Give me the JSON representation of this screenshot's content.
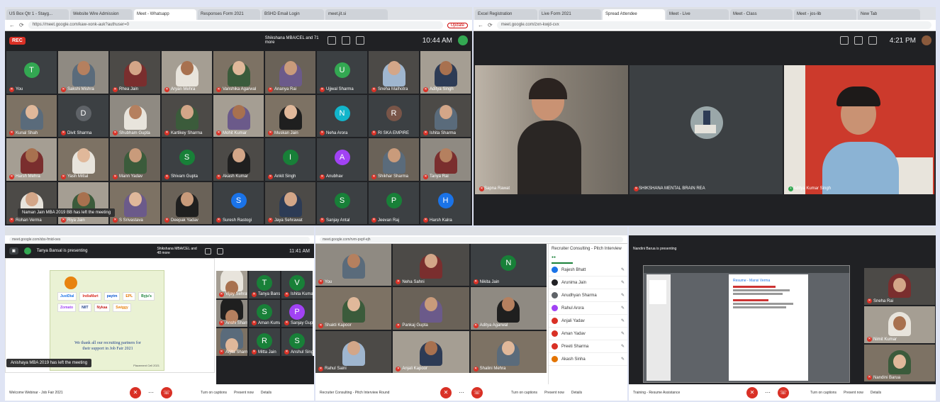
{
  "q1": {
    "tabs": [
      "US Box Qtr 1 - Stayg...",
      "Website Wire Admission",
      "Meet - Whatsapp",
      "Responses Form 2021",
      "BSHD Email Login",
      "meet.jit.si"
    ],
    "url": "https://meet.google.com/kaw-xonk-auk?authuser=0",
    "update_label": "Update",
    "rec_label": "REC",
    "presenter": "Shikshana MBA/CEL and 71 more",
    "clock": "10:44 AM",
    "left_notice": "Naman Jain MBA 2019 BB has left the meeting",
    "participants": [
      {
        "name": "You",
        "letter": "T",
        "color": "#33a852"
      },
      {
        "name": "Sakshi Mishra",
        "letter": "",
        "color": ""
      },
      {
        "name": "Rhea Jain",
        "letter": "",
        "color": ""
      },
      {
        "name": "Aryan Mehra",
        "letter": "",
        "color": ""
      },
      {
        "name": "Vanshika Agarwal",
        "letter": "",
        "color": ""
      },
      {
        "name": "Ananya Rai",
        "letter": "",
        "color": ""
      },
      {
        "name": "Ujjwal Sharma",
        "letter": "U",
        "color": "#33a852"
      },
      {
        "name": "Sneha Malhotra",
        "letter": "",
        "color": ""
      },
      {
        "name": "Aditya Singh",
        "letter": "",
        "color": ""
      },
      {
        "name": "Kunal Shah",
        "letter": "",
        "color": ""
      },
      {
        "name": "Divit Sharma",
        "letter": "D",
        "color": "#5f6368"
      },
      {
        "name": "Shubham Gupta",
        "letter": "",
        "color": ""
      },
      {
        "name": "Kartikey Sharma",
        "letter": "",
        "color": ""
      },
      {
        "name": "Mohit Kumar",
        "letter": "",
        "color": ""
      },
      {
        "name": "Muskan Jain",
        "letter": "",
        "color": ""
      },
      {
        "name": "Neha Arora",
        "letter": "N",
        "color": "#12b5cb"
      },
      {
        "name": "RI SKA EMPIRE",
        "letter": "R",
        "color": "#795548"
      },
      {
        "name": "Ishita Sharma",
        "letter": "",
        "color": ""
      },
      {
        "name": "Harsh Mehra",
        "letter": "",
        "color": ""
      },
      {
        "name": "Yash Mittal",
        "letter": "",
        "color": ""
      },
      {
        "name": "Mann Yadav",
        "letter": "",
        "color": ""
      },
      {
        "name": "Shivam Gupta",
        "letter": "S",
        "color": "#188038"
      },
      {
        "name": "Akash Kumar",
        "letter": "",
        "color": ""
      },
      {
        "name": "Ankit Singh",
        "letter": "I",
        "color": "#188038"
      },
      {
        "name": "Anubhav",
        "letter": "A",
        "color": "#a142f4"
      },
      {
        "name": "Shikhar Sharma",
        "letter": "",
        "color": ""
      },
      {
        "name": "Tanya Rai",
        "letter": "",
        "color": ""
      },
      {
        "name": "Rohan Verma",
        "letter": "",
        "color": ""
      },
      {
        "name": "Riya Jain",
        "letter": "",
        "color": ""
      },
      {
        "name": "S Srivastava",
        "letter": "",
        "color": ""
      },
      {
        "name": "Deepak Yadav",
        "letter": "",
        "color": ""
      },
      {
        "name": "Suresh Rastogi",
        "letter": "S",
        "color": "#1a73e8"
      },
      {
        "name": "Jaya Sehrawat",
        "letter": "",
        "color": ""
      },
      {
        "name": "Sanjay Antal",
        "letter": "S",
        "color": "#188038"
      },
      {
        "name": "Jeevan Raj",
        "letter": "P",
        "color": "#188038"
      },
      {
        "name": "Harsh Kalra",
        "letter": "H",
        "color": "#1a73e8"
      }
    ]
  },
  "q2": {
    "tabs": [
      "Excel Registration",
      "Live Form 2021",
      "Spread Attendee",
      "Meet - Live",
      "Meet - Class",
      "Meet - jos-lib",
      "New Tab"
    ],
    "url": "meet.google.com/zxn-kwjd-cvx",
    "clock": "4:21 PM",
    "speakers": [
      {
        "name": "Sapna Rawat"
      },
      {
        "name": "SHIKSHANA MENTAL BRAIN REA"
      },
      {
        "name": "Aditya Kumar Singh"
      }
    ]
  },
  "q3": {
    "url": "meet.google.com/sbs-fmid-oes",
    "presenting": "Tanya Bansal is presenting",
    "presenter": "Shikshana MBA/CEL and 48 more",
    "clock": "11:41 AM",
    "slide_line1": "We thank all our recruiting partners for",
    "slide_line2": "their support in Job Fair 2021",
    "slide_footer": "Placement Cell 2021",
    "logos": [
      "JustDial",
      "IndiaMart",
      "paytm",
      "EPL",
      "Byju's",
      "Zomato",
      "NIIT",
      "Nykaa",
      "Swiggy"
    ],
    "side": [
      {
        "name": "Vijay Sehrawat",
        "letter": "",
        "color": ""
      },
      {
        "name": "Tanya Bansal",
        "letter": "T",
        "color": "#188038"
      },
      {
        "name": "Ishita Kumar",
        "letter": "V",
        "color": "#188038"
      },
      {
        "name": "Anshi Sharma",
        "letter": "",
        "color": ""
      },
      {
        "name": "Aman Kumar",
        "letter": "S",
        "color": "#188038"
      },
      {
        "name": "Sanjay Gupta",
        "letter": "P",
        "color": "#a142f4"
      },
      {
        "name": "Arjita Sharma",
        "letter": "",
        "color": ""
      },
      {
        "name": "Mitta Jain",
        "letter": "R",
        "color": "#188038"
      },
      {
        "name": "Anshul Singh",
        "letter": "S",
        "color": "#188038"
      }
    ],
    "notice": "Anishaya MBA 2019 has left the meeting",
    "meeting_name": "Welcome Webinar - Job Fair 2021",
    "b1": "Turn on captions",
    "b2": "Present now",
    "b3": "Details"
  },
  "q4": {
    "url": "meet.google.com/rvm-pxpf-ejh",
    "tiles": [
      {
        "name": "You",
        "letter": "",
        "color": ""
      },
      {
        "name": "Neha Sahni",
        "letter": "",
        "color": ""
      },
      {
        "name": "Nikita Jain",
        "letter": "N",
        "color": "#188038"
      },
      {
        "name": "Shakti Kapoor",
        "letter": "",
        "color": ""
      },
      {
        "name": "Pankaj Gupta",
        "letter": "",
        "color": ""
      },
      {
        "name": "Aditya Agarwal",
        "letter": "",
        "color": ""
      },
      {
        "name": "Rahul Saini",
        "letter": "",
        "color": ""
      },
      {
        "name": "Anjali Kapoor",
        "letter": "",
        "color": ""
      },
      {
        "name": "Shalini Mehra",
        "letter": "",
        "color": ""
      }
    ],
    "panel_title": "Recruiter Consulting - Pitch Interview",
    "panel_rows": [
      {
        "name": "Rajesh Bhatt",
        "color": "#1a73e8"
      },
      {
        "name": "Arunima Jain",
        "color": "#202124"
      },
      {
        "name": "Anudhyan Sharma",
        "color": "#5f6368"
      },
      {
        "name": "Rahul Arora",
        "color": "#a142f4"
      },
      {
        "name": "Anjali Yadav",
        "color": "#d93025"
      },
      {
        "name": "Aman Yadav",
        "color": "#d93025"
      },
      {
        "name": "Preeti Sharma",
        "color": "#d93025"
      },
      {
        "name": "Akash Sinha",
        "color": "#e37400"
      }
    ],
    "meeting_name": "Recruiter Consulting - Pitch Interview Round",
    "b1": "Turn on captions",
    "b2": "Present now",
    "b3": "Details"
  },
  "q5": {
    "presenting": "Nandini Barua is presenting",
    "doc_title": "Resume - Mansi Verma",
    "side": [
      {
        "name": "Sneha Rai",
        "letter": "",
        "color": ""
      },
      {
        "name": "Nimit Kumar",
        "letter": "",
        "color": ""
      },
      {
        "name": "Nandini Barua",
        "letter": "",
        "color": ""
      }
    ],
    "meeting_name": "Training - Resume Assistance",
    "b1": "Turn on captions",
    "b2": "Present now",
    "b3": "Details"
  }
}
